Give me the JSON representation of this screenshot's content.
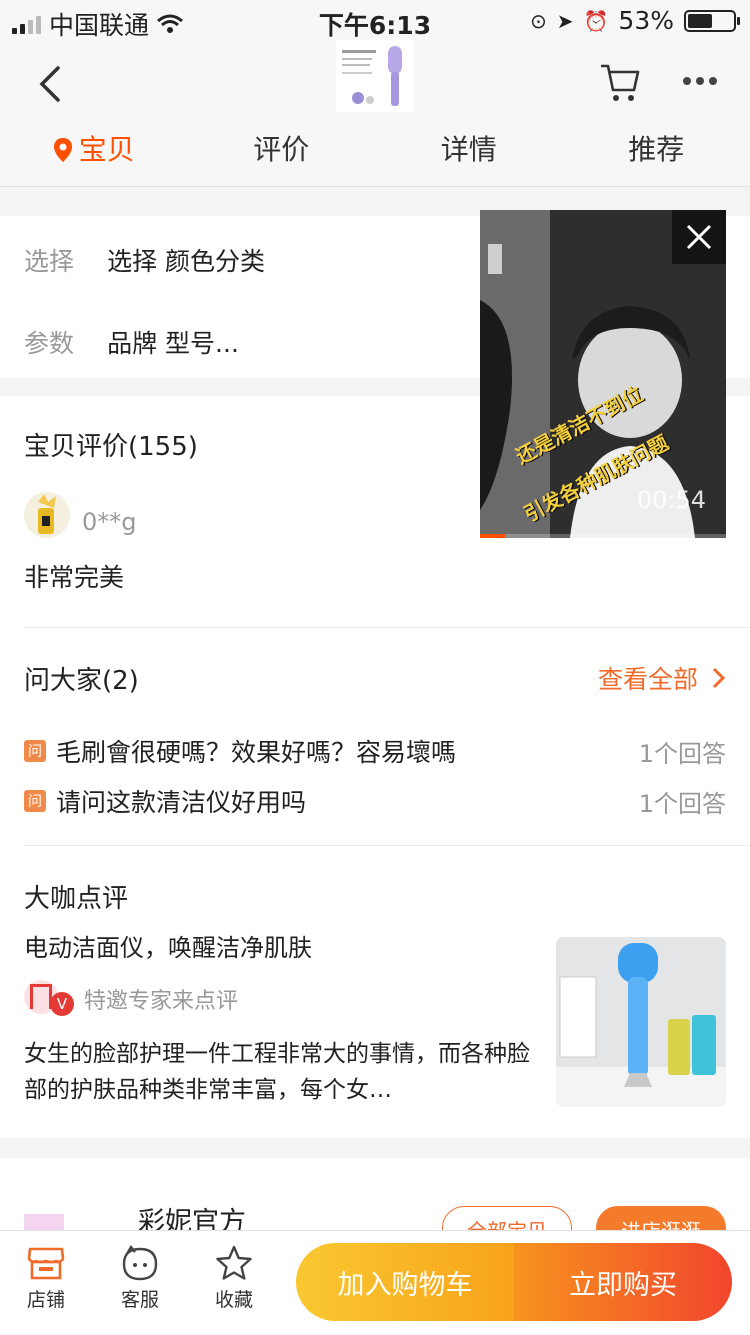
{
  "status": {
    "carrier": "中国联通",
    "time": "下午6:13",
    "battery": "53%"
  },
  "nav": {
    "tabs": [
      "宝贝",
      "评价",
      "详情",
      "推荐"
    ],
    "active_tab": 0
  },
  "selection": {
    "choose_label": "选择",
    "choose_value": "选择 颜色分类",
    "param_label": "参数",
    "param_value": "品牌 型号..."
  },
  "reviews": {
    "title": "宝贝评价(155)",
    "user": "0**g",
    "content": "非常完美"
  },
  "video": {
    "duration": "00:54",
    "caption_line1": "还是清洁不到位",
    "caption_line2": "引发各种肌肤问题",
    "progress": 0.1
  },
  "qa": {
    "title": "问大家(2)",
    "view_all": "查看全部",
    "icon_label": "问",
    "items": [
      {
        "question": "毛刷會很硬嗎？效果好嗎？容易壞嗎",
        "answers": "1个回答"
      },
      {
        "question": "请问这款清洁仪好用吗",
        "answers": "1个回答"
      }
    ]
  },
  "expert": {
    "title": "大咖点评",
    "headline": "电动洁面仪，唤醒洁净肌肤",
    "invite": "特邀专家来点评",
    "body": "女生的脸部护理一件工程非常大的事情，而各种脸部的护肤品种类非常丰富，每个女…"
  },
  "shop": {
    "name": "彩妮官方",
    "btn_all": "全部宝贝",
    "btn_enter": "进店逛逛"
  },
  "bottom": {
    "store": "店铺",
    "service": "客服",
    "favorite": "收藏",
    "add_to_cart": "加入购物车",
    "buy_now": "立即购买"
  },
  "colors": {
    "accent": "#ff5000",
    "cart_gradient_start": "#f9c830",
    "cart_gradient_end": "#f8a31a",
    "buy_gradient_start": "#f7931e",
    "buy_gradient_end": "#f1452d"
  }
}
